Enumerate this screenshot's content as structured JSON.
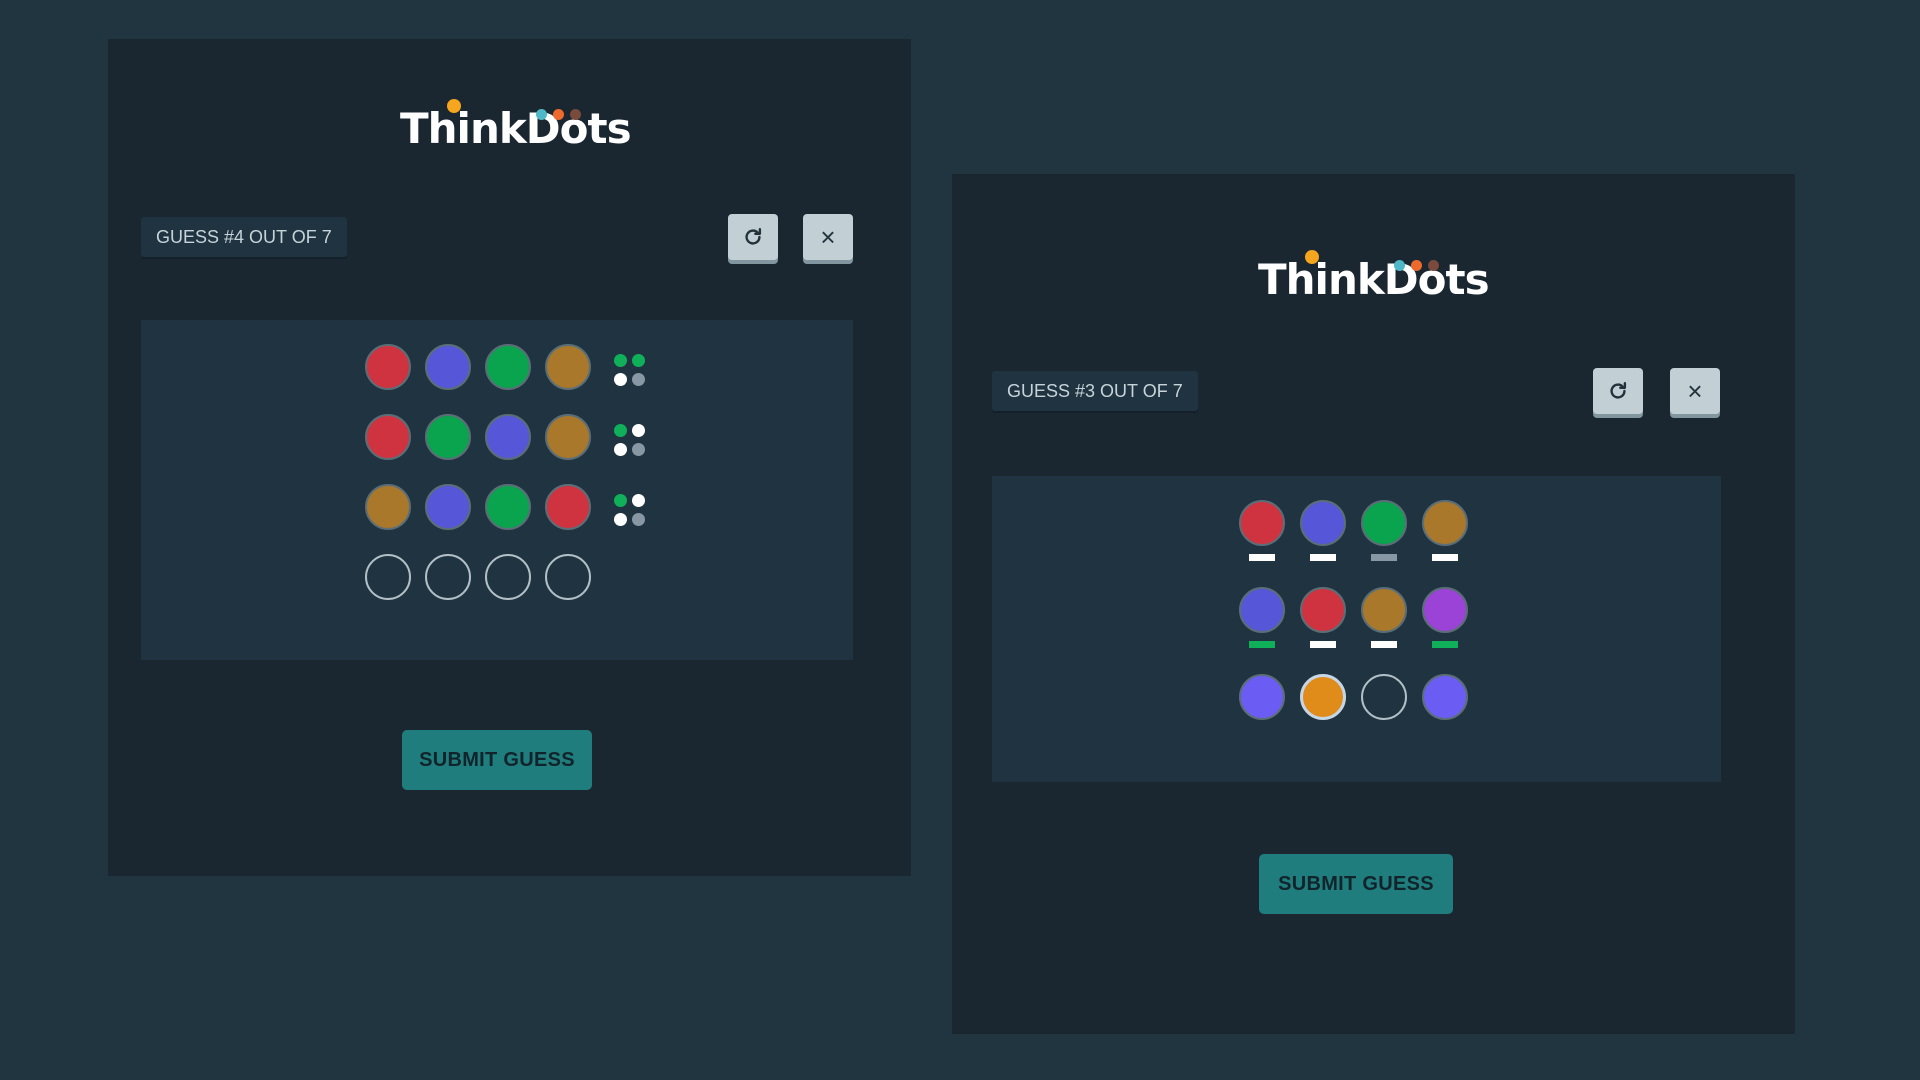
{
  "colors": {
    "red": "#d03340",
    "blue": "#5656d8",
    "green": "#0aa34e",
    "gold": "#a9782a",
    "purple": "#9a43d6",
    "light_blue": "#6b5cf4",
    "orange": "#df8c1a",
    "peg_key_green": "#10b05a",
    "peg_key_white": "#ffffff",
    "peg_key_grey": "#8797a3",
    "logo_yellow": "#f5a51e",
    "logo_cyan": "#4fb8c8",
    "logo_orange": "#ee6a2c",
    "logo_brown": "#7a4a3c"
  },
  "left_game": {
    "logo_text": "ThinkDots",
    "guess_label": "GUESS #4 OUT OF 7",
    "reset_icon": "refresh-icon",
    "close_icon": "close-icon",
    "close_glyph": "×",
    "submit_label": "SUBMIT GUESS",
    "rows": [
      {
        "pegs": [
          "red",
          "blue",
          "green",
          "gold"
        ],
        "key": [
          "green",
          "green",
          "white",
          "grey"
        ]
      },
      {
        "pegs": [
          "red",
          "green",
          "blue",
          "gold"
        ],
        "key": [
          "green",
          "white",
          "white",
          "grey"
        ]
      },
      {
        "pegs": [
          "gold",
          "blue",
          "green",
          "red"
        ],
        "key": [
          "green",
          "white",
          "white",
          "grey"
        ]
      },
      {
        "pegs": [
          "empty",
          "empty",
          "empty",
          "empty"
        ],
        "key": []
      }
    ]
  },
  "right_game": {
    "logo_text": "ThinkDots",
    "guess_label": "GUESS #3 OUT OF 7",
    "reset_icon": "refresh-icon",
    "close_icon": "close-icon",
    "close_glyph": "×",
    "submit_label": "SUBMIT GUESS",
    "rows": [
      {
        "pegs": [
          "red",
          "blue",
          "green",
          "gold"
        ],
        "bars": [
          "white",
          "white",
          "grey",
          "white"
        ]
      },
      {
        "pegs": [
          "blue",
          "red",
          "gold",
          "purple"
        ],
        "bars": [
          "green",
          "white",
          "white",
          "green"
        ]
      },
      {
        "pegs": [
          "light_blue",
          "orange",
          "empty",
          "light_blue"
        ],
        "selected": 1,
        "bars": []
      }
    ]
  }
}
